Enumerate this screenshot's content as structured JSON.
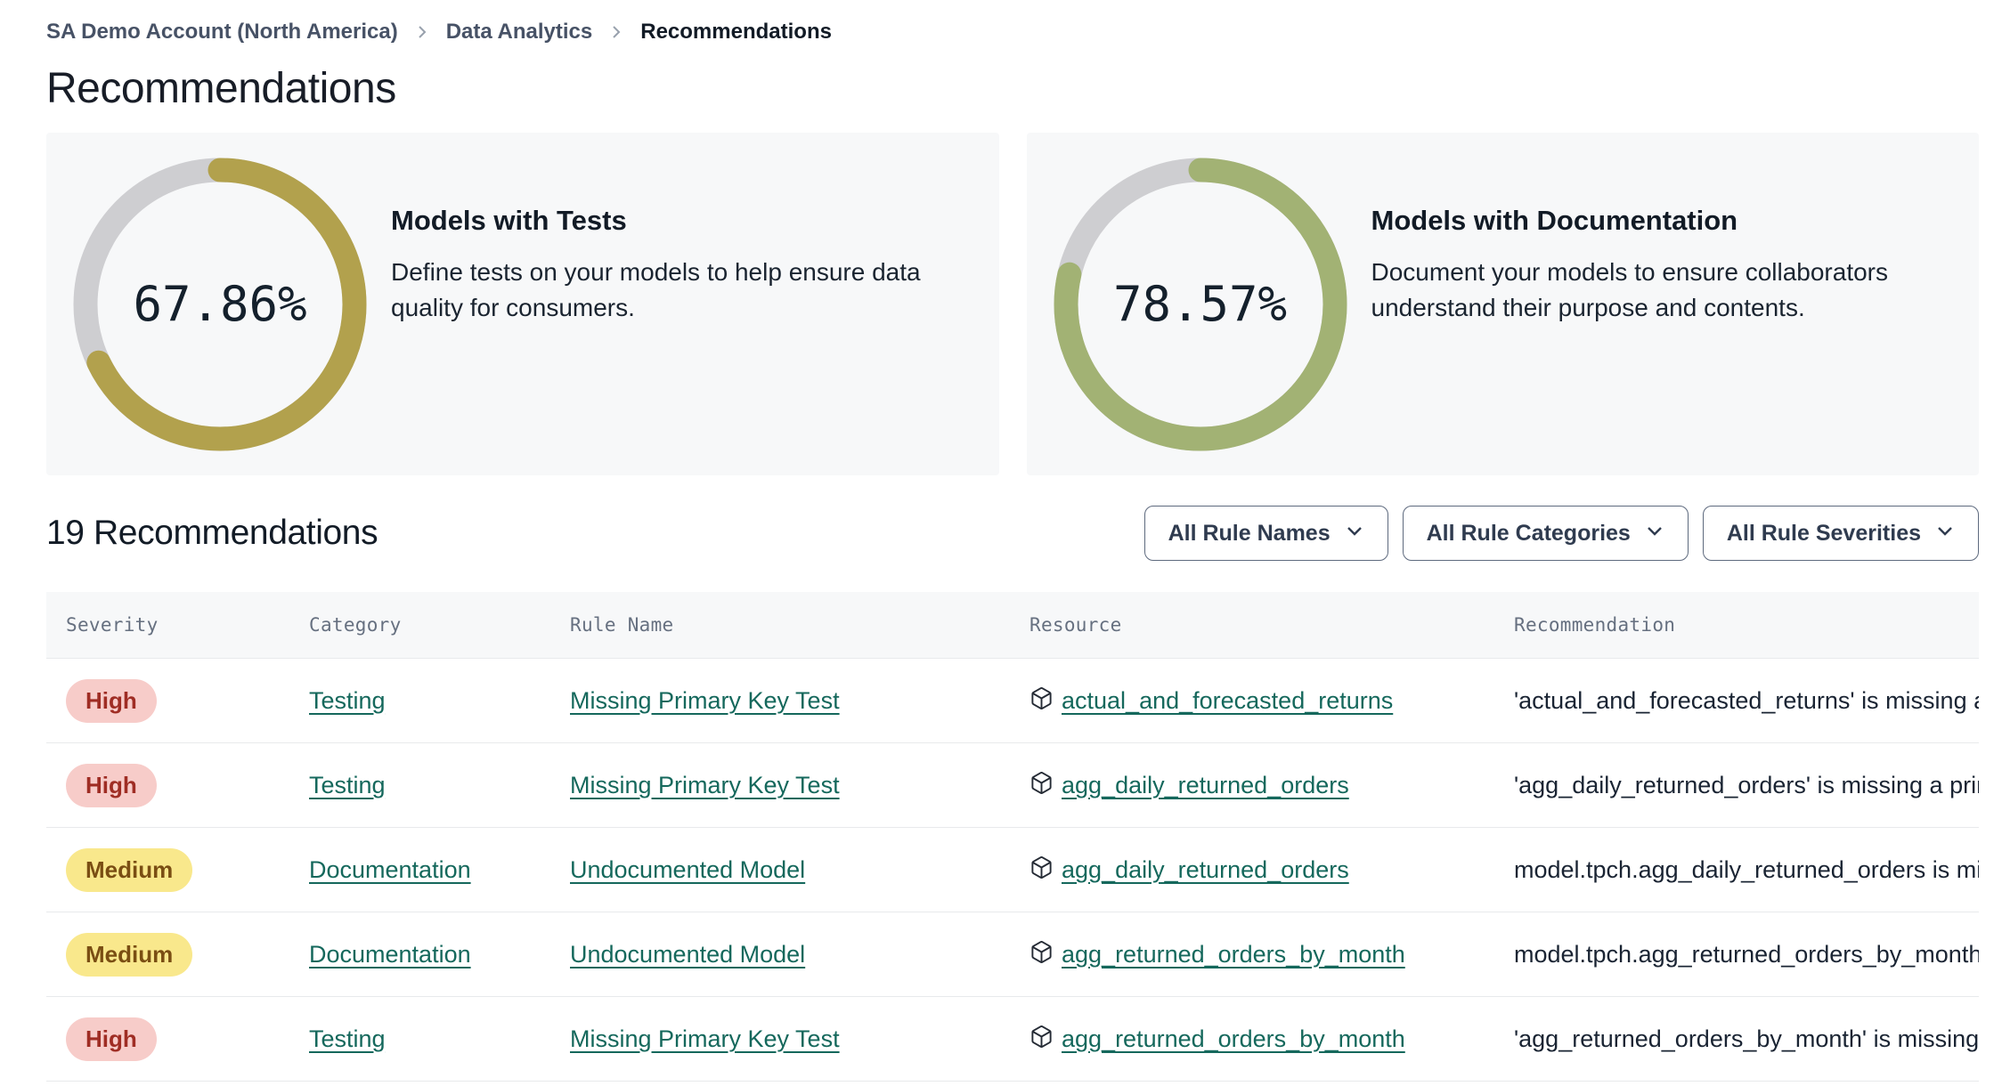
{
  "breadcrumb": {
    "items": [
      {
        "label": "SA Demo Account (North America)"
      },
      {
        "label": "Data Analytics"
      },
      {
        "label": "Recommendations"
      }
    ]
  },
  "page_title": "Recommendations",
  "cards": [
    {
      "title": "Models with Tests",
      "description": "Define tests on your models to help ensure data quality for consumers.",
      "percent": "67.86%",
      "percent_value": 67.86,
      "arc_color": "#b2a14d",
      "track_color": "#ceced1"
    },
    {
      "title": "Models with Documentation",
      "description": "Document your models to ensure collaborators understand their purpose and contents.",
      "percent": "78.57%",
      "percent_value": 78.57,
      "arc_color": "#a2b274",
      "track_color": "#ceced1"
    }
  ],
  "list_header": {
    "count_title": "19 Recommendations",
    "filters": [
      {
        "label": "All Rule Names"
      },
      {
        "label": "All Rule Categories"
      },
      {
        "label": "All Rule Severities"
      }
    ]
  },
  "table": {
    "columns": [
      "Severity",
      "Category",
      "Rule Name",
      "Resource",
      "Recommendation"
    ],
    "rows": [
      {
        "severity": "High",
        "severity_level": "high",
        "category": "Testing",
        "rule_name": "Missing Primary Key Test",
        "resource": "actual_and_forecasted_returns",
        "recommendation": "'actual_and_forecasted_returns' is missing a …"
      },
      {
        "severity": "High",
        "severity_level": "high",
        "category": "Testing",
        "rule_name": "Missing Primary Key Test",
        "resource": "agg_daily_returned_orders",
        "recommendation": "'agg_daily_returned_orders' is missing a prim…"
      },
      {
        "severity": "Medium",
        "severity_level": "medium",
        "category": "Documentation",
        "rule_name": "Undocumented Model",
        "resource": "agg_daily_returned_orders",
        "recommendation": "model.tpch.agg_daily_returned_orders is mis…"
      },
      {
        "severity": "Medium",
        "severity_level": "medium",
        "category": "Documentation",
        "rule_name": "Undocumented Model",
        "resource": "agg_returned_orders_by_month",
        "recommendation": "model.tpch.agg_returned_orders_by_month …"
      },
      {
        "severity": "High",
        "severity_level": "high",
        "category": "Testing",
        "rule_name": "Missing Primary Key Test",
        "resource": "agg_returned_orders_by_month",
        "recommendation": "'agg_returned_orders_by_month' is missing …"
      }
    ]
  }
}
